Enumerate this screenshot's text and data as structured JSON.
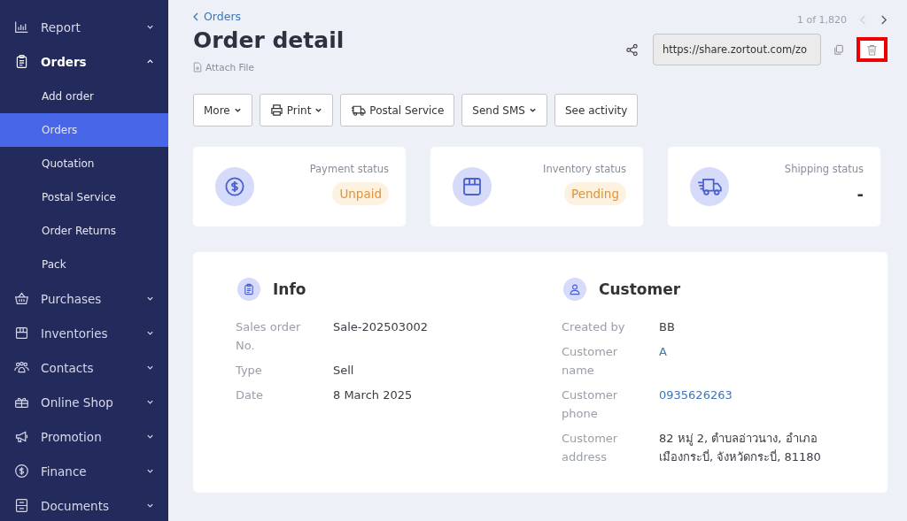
{
  "sidebar": {
    "items": [
      {
        "label": "Report",
        "expanded": false
      },
      {
        "label": "Orders",
        "expanded": true,
        "children": [
          {
            "label": "Add order",
            "selected": false
          },
          {
            "label": "Orders",
            "selected": true
          },
          {
            "label": "Quotation",
            "selected": false
          },
          {
            "label": "Postal Service",
            "selected": false
          },
          {
            "label": "Order Returns",
            "selected": false
          },
          {
            "label": "Pack",
            "selected": false
          }
        ]
      },
      {
        "label": "Purchases",
        "expanded": false
      },
      {
        "label": "Inventories",
        "expanded": false
      },
      {
        "label": "Contacts",
        "expanded": false
      },
      {
        "label": "Online Shop",
        "expanded": false
      },
      {
        "label": "Promotion",
        "expanded": false
      },
      {
        "label": "Finance",
        "expanded": false
      },
      {
        "label": "Documents",
        "expanded": false
      }
    ]
  },
  "header": {
    "breadcrumb": "Orders",
    "title": "Order detail",
    "attach": "Attach File",
    "pager": "1 of 1,820",
    "share_url": "https://share.zortout.com/zo"
  },
  "toolbar": [
    {
      "label": "More",
      "dropdown": true
    },
    {
      "label": "Print",
      "dropdown": true
    },
    {
      "label": "Postal Service",
      "dropdown": false
    },
    {
      "label": "Send SMS",
      "dropdown": true
    },
    {
      "label": "See activity",
      "dropdown": false
    }
  ],
  "status_cards": [
    {
      "label": "Payment status",
      "value": "Unpaid",
      "kind": "badge"
    },
    {
      "label": "Inventory status",
      "value": "Pending",
      "kind": "badge"
    },
    {
      "label": "Shipping status",
      "value": "-",
      "kind": "plain"
    }
  ],
  "sections": [
    {
      "title": "Info",
      "rows": [
        {
          "label": "Sales order No.",
          "value": "Sale-202503002",
          "kind": "text"
        },
        {
          "label": "Type",
          "value": "Sell",
          "kind": "text"
        },
        {
          "label": "Date",
          "value": "8 March 2025",
          "kind": "text"
        }
      ]
    },
    {
      "title": "Customer",
      "rows": [
        {
          "label": "Created by",
          "value": "BB",
          "kind": "text"
        },
        {
          "label": "Customer name",
          "value": "A",
          "kind": "link"
        },
        {
          "label": "Customer phone",
          "value": "0935626263",
          "kind": "link"
        },
        {
          "label": "Customer address",
          "value": "82 หมู่ 2, ตำบลอ่าวนาง, อำเภอเมืองกระบี่, จังหวัดกระบี่, 81180",
          "kind": "text"
        }
      ]
    }
  ]
}
